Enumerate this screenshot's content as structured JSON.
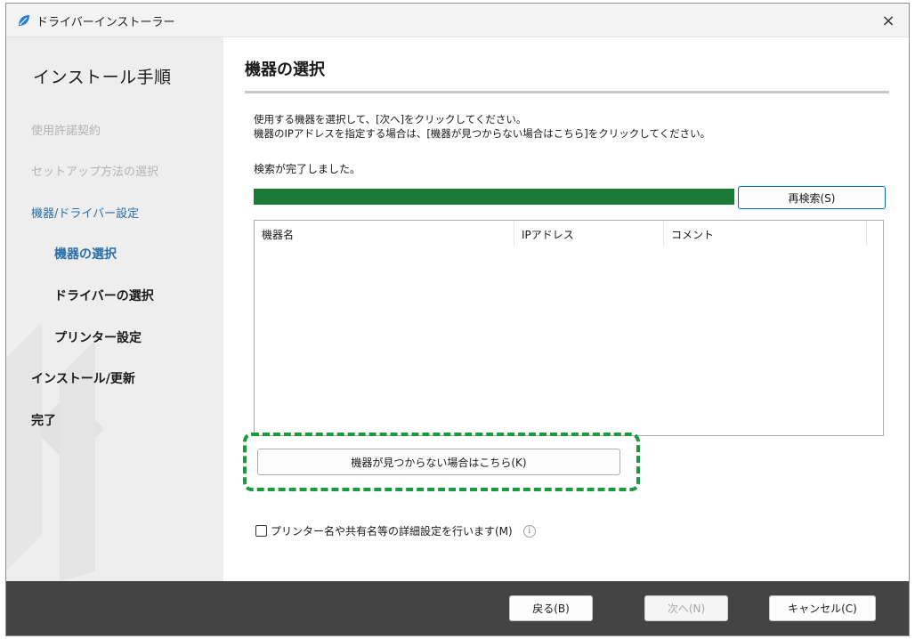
{
  "window": {
    "title": "ドライバーインストーラー",
    "close_label": "×"
  },
  "sidebar": {
    "title": "インストール手順",
    "steps": [
      {
        "label": "使用許諾契約",
        "state": "done"
      },
      {
        "label": "セットアップ方法の選択",
        "state": "done"
      },
      {
        "label": "機器/ドライバー設定",
        "state": "active-group"
      },
      {
        "label": "機器の選択",
        "state": "current"
      },
      {
        "label": "ドライバーの選択",
        "state": "pending"
      },
      {
        "label": "プリンター設定",
        "state": "pending"
      },
      {
        "label": "インストール/更新",
        "state": "pending"
      },
      {
        "label": "完了",
        "state": "pending"
      }
    ]
  },
  "main": {
    "title": "機器の選択",
    "instructions": [
      "使用する機器を選択して、[次へ]をクリックしてください。",
      "機器のIPアドレスを指定する場合は、[機器が見つからない場合はこちら]をクリックしてください。"
    ],
    "status": "検索が完了しました。",
    "progress": 100,
    "rescan_label": "再検索(S)",
    "table": {
      "columns": [
        "機器名",
        "IPアドレス",
        "コメント"
      ],
      "rows": []
    },
    "not_found_label": "機器が見つからない場合はこちら(K)",
    "checkbox_label": "プリンター名や共有名等の詳細設定を行います(M)",
    "checkbox_checked": false,
    "info_glyph": "i"
  },
  "footer": {
    "back_label": "戻る(B)",
    "next_label": "次へ(N)",
    "cancel_label": "キャンセル(C)"
  },
  "colors": {
    "accent": "#2a6fa8",
    "progress": "#1b7a35",
    "highlight": "#189c3f",
    "footer_bg": "#444444",
    "sidebar_bg": "#eeeeee"
  },
  "icons": {
    "app": "leaf-icon",
    "close": "close-icon",
    "info": "info-icon"
  }
}
